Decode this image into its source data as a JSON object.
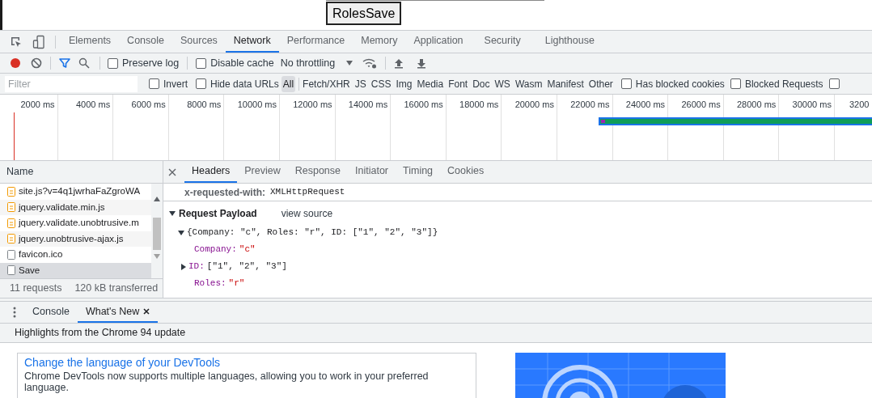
{
  "page": {
    "button": "RolesSave"
  },
  "devtools_tabs": [
    {
      "label": "Elements",
      "selected": false
    },
    {
      "label": "Console",
      "selected": false
    },
    {
      "label": "Sources",
      "selected": false
    },
    {
      "label": "Network",
      "selected": true
    },
    {
      "label": "Performance",
      "selected": false
    },
    {
      "label": "Memory",
      "selected": false
    },
    {
      "label": "Application",
      "selected": false
    },
    {
      "label": "Security",
      "selected": false
    },
    {
      "label": "Lighthouse",
      "selected": false
    }
  ],
  "toolbar": {
    "recording": true,
    "filter_active": true,
    "checkboxes": [
      {
        "label": "Preserve log",
        "checked": false
      },
      {
        "label": "Disable cache",
        "checked": false
      }
    ],
    "throttling": "No throttling"
  },
  "filter_bar": {
    "placeholder": "Filter",
    "checkboxes": [
      {
        "label": "Invert",
        "checked": false
      },
      {
        "label": "Hide data URLs",
        "checked": false
      }
    ],
    "types": [
      {
        "label": "All",
        "selected": true
      },
      {
        "label": "Fetch/XHR",
        "selected": false
      },
      {
        "label": "JS",
        "selected": false
      },
      {
        "label": "CSS",
        "selected": false
      },
      {
        "label": "Img",
        "selected": false
      },
      {
        "label": "Media",
        "selected": false
      },
      {
        "label": "Font",
        "selected": false
      },
      {
        "label": "Doc",
        "selected": false
      },
      {
        "label": "WS",
        "selected": false
      },
      {
        "label": "Wasm",
        "selected": false
      },
      {
        "label": "Manifest",
        "selected": false
      },
      {
        "label": "Other",
        "selected": false
      }
    ],
    "options": [
      {
        "label": "Has blocked cookies",
        "checked": false
      },
      {
        "label": "Blocked Requests",
        "checked": false
      },
      {
        "checked": false
      }
    ]
  },
  "timeline": {
    "ticks": [
      "2000 ms",
      "4000 ms",
      "6000 ms",
      "8000 ms",
      "10000 ms",
      "12000 ms",
      "14000 ms",
      "16000 ms",
      "18000 ms",
      "20000 ms",
      "22000 ms",
      "24000 ms",
      "26000 ms",
      "28000 ms",
      "30000 ms",
      "3200"
    ]
  },
  "requests": {
    "column": "Name",
    "rows": [
      {
        "name": "site.js?v=4q1jwrhaFaZgroWA",
        "kind": "script",
        "selected": false
      },
      {
        "name": "jquery.validate.min.js",
        "kind": "script",
        "selected": false
      },
      {
        "name": "jquery.validate.unobtrusive.m",
        "kind": "script",
        "selected": false
      },
      {
        "name": "jquery.unobtrusive-ajax.js",
        "kind": "script",
        "selected": false
      },
      {
        "name": "favicon.ico",
        "kind": "other",
        "selected": false
      },
      {
        "name": "Save",
        "kind": "other",
        "selected": true
      }
    ],
    "summary": [
      "11 requests",
      "120 kB transferred"
    ]
  },
  "details": {
    "tabs": [
      {
        "label": "Headers",
        "selected": true
      },
      {
        "label": "Preview",
        "selected": false
      },
      {
        "label": "Response",
        "selected": false
      },
      {
        "label": "Initiator",
        "selected": false
      },
      {
        "label": "Timing",
        "selected": false
      },
      {
        "label": "Cookies",
        "selected": false
      }
    ],
    "header": {
      "name": "x-requested-with:",
      "value": "XMLHttpRequest"
    },
    "payload": {
      "title": "Request Payload",
      "expanded": true,
      "view_source": "view source",
      "summary": "{Company: \"c\", Roles: \"r\", ID: [\"1\", \"2\", \"3\"]}",
      "summary_expanded": true,
      "fields": [
        {
          "key": "Company:",
          "value": "\"c\"",
          "kind": "string"
        },
        {
          "key": "ID:",
          "value": "[\"1\", \"2\", \"3\"]",
          "kind": "array",
          "expanded": false
        },
        {
          "key": "Roles:",
          "value": "\"r\"",
          "kind": "string"
        }
      ]
    }
  },
  "drawer": {
    "tabs": [
      {
        "label": "Console",
        "selected": false,
        "closable": false
      },
      {
        "label": "What's New",
        "selected": true,
        "closable": true
      }
    ],
    "headline": "Highlights from the Chrome 94 update",
    "card": {
      "title": "Change the language of your DevTools",
      "text": "Chrome DevTools now supports multiple languages, allowing you to work in your preferred language."
    }
  }
}
